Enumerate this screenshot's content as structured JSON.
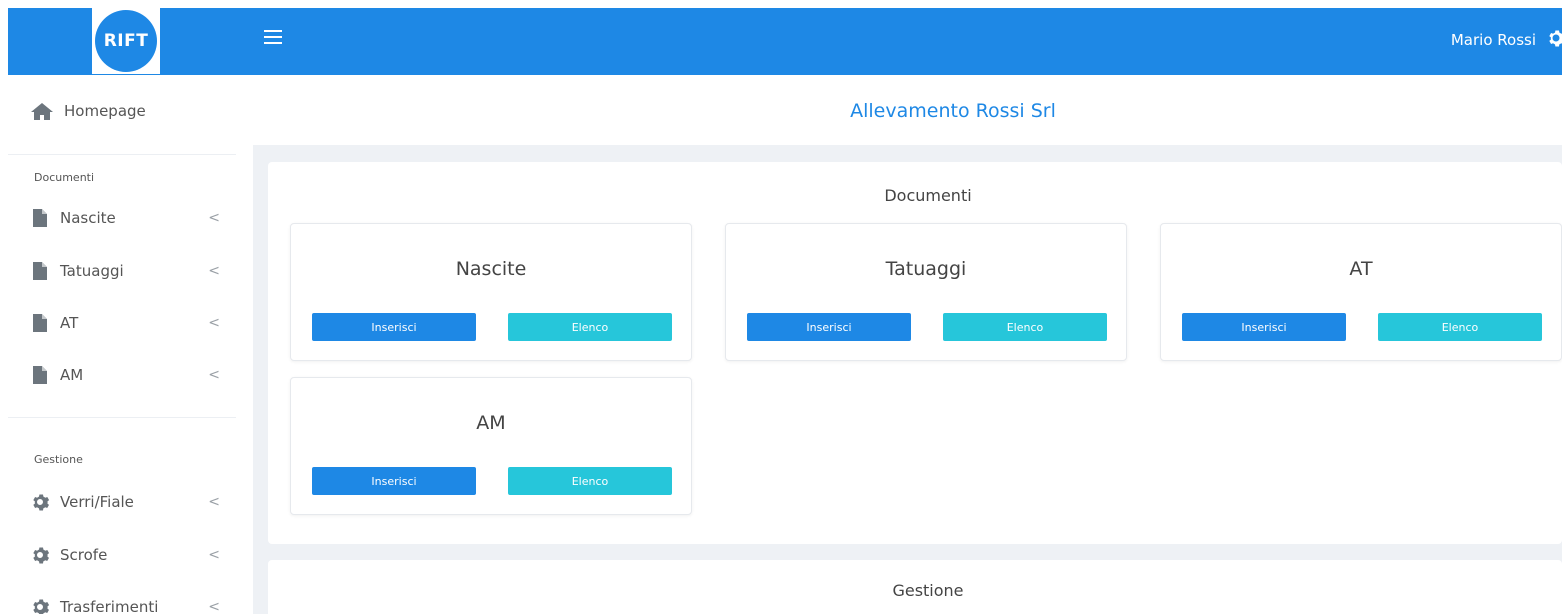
{
  "topbar": {
    "logo_text": "RIFT",
    "user_name": "Mario Rossi",
    "brand_color": "#1e88e5"
  },
  "sidebar": {
    "home_label": "Homepage",
    "sections": [
      {
        "title": "Documenti",
        "items": [
          {
            "label": "Nascite",
            "icon": "file-icon"
          },
          {
            "label": "Tatuaggi",
            "icon": "file-icon"
          },
          {
            "label": "AT",
            "icon": "file-icon"
          },
          {
            "label": "AM",
            "icon": "file-icon"
          }
        ]
      },
      {
        "title": "Gestione",
        "items": [
          {
            "label": "Verri/Fiale",
            "icon": "gear-icon"
          },
          {
            "label": "Scrofe",
            "icon": "gear-icon"
          },
          {
            "label": "Trasferimenti",
            "icon": "gear-icon"
          }
        ]
      }
    ],
    "chevron": "<"
  },
  "main": {
    "page_title": "Allevamento Rossi Srl",
    "documenti_panel": {
      "title": "Documenti",
      "cards": [
        {
          "title": "Nascite",
          "insert_label": "Inserisci",
          "list_label": "Elenco"
        },
        {
          "title": "Tatuaggi",
          "insert_label": "Inserisci",
          "list_label": "Elenco"
        },
        {
          "title": "AT",
          "insert_label": "Inserisci",
          "list_label": "Elenco"
        },
        {
          "title": "AM",
          "insert_label": "Inserisci",
          "list_label": "Elenco"
        }
      ]
    },
    "gestione_panel": {
      "title": "Gestione"
    }
  },
  "colors": {
    "primary": "#1e88e5",
    "info": "#26c6da",
    "background": "#eef1f5"
  }
}
